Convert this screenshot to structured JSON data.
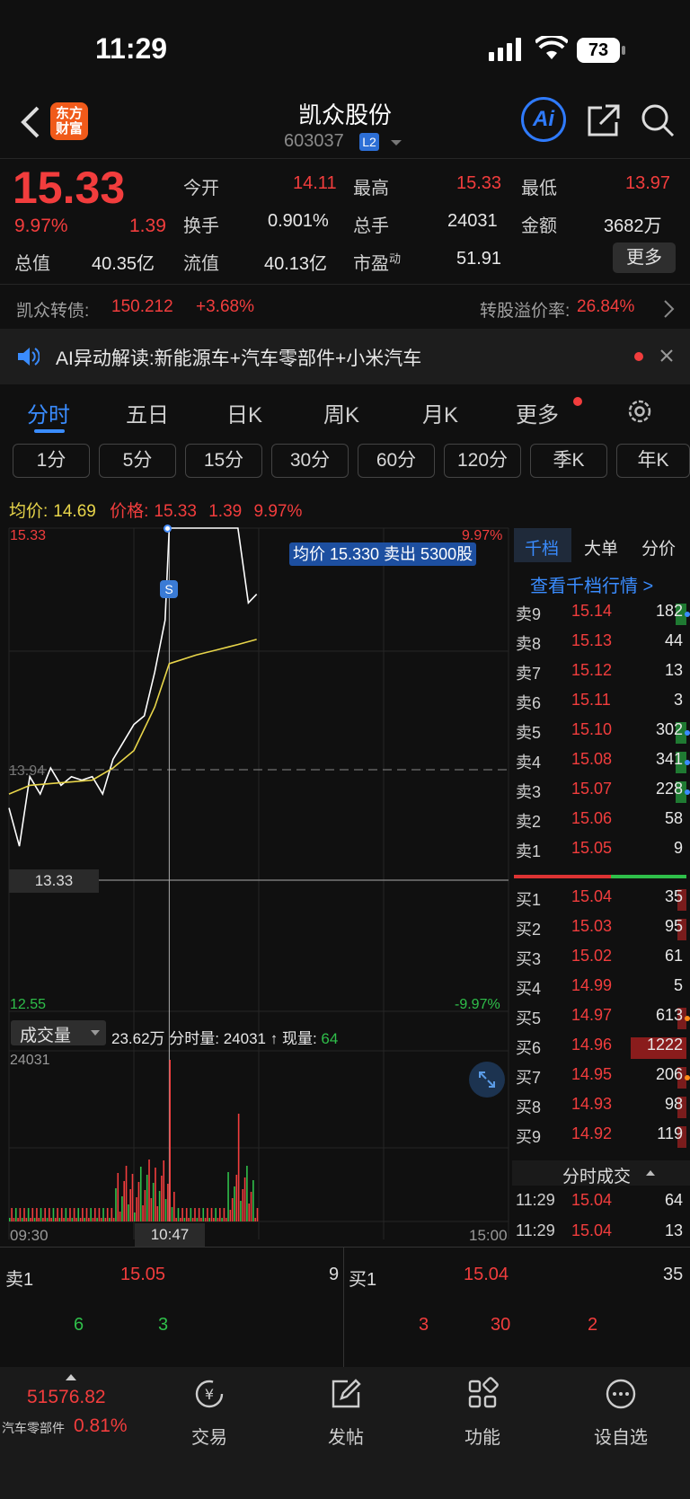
{
  "status_bar": {
    "time": "11:29",
    "battery": "73"
  },
  "nav": {
    "brand": "东方\n财富",
    "title": "凯众股份",
    "code": "603037",
    "level": "L2"
  },
  "quote": {
    "price": "15.33",
    "change_pct": "9.97%",
    "change": "1.39",
    "fields": [
      {
        "label": "今开",
        "value": "14.11",
        "color": "red"
      },
      {
        "label": "最高",
        "value": "15.33",
        "color": "red"
      },
      {
        "label": "最低",
        "value": "13.97",
        "color": "red"
      },
      {
        "label": "换手",
        "value": "0.901%",
        "color": "white"
      },
      {
        "label": "总手",
        "value": "24031",
        "color": "white"
      },
      {
        "label": "金额",
        "value": "3682万",
        "color": "white"
      },
      {
        "label": "总值",
        "value": "40.35亿",
        "color": "white"
      },
      {
        "label": "流值",
        "value": "40.13亿",
        "color": "white"
      },
      {
        "label": "市盈",
        "value": "51.91",
        "color": "white",
        "sup": "动"
      }
    ],
    "more_label": "更多"
  },
  "bond": {
    "name": "凯众转债:",
    "price": "150.212",
    "change": "+3.68%",
    "premium_label": "转股溢价率:",
    "premium": "26.84%"
  },
  "ai_bar": {
    "text": "AI异动解读:新能源车+汽车零部件+小米汽车"
  },
  "tabs": [
    "分时",
    "五日",
    "日K",
    "周K",
    "月K",
    "更多"
  ],
  "periods": [
    "1分",
    "5分",
    "15分",
    "30分",
    "60分",
    "120分",
    "季K",
    "年K"
  ],
  "chart_info": {
    "avg_label": "均价:",
    "avg_value": "14.69",
    "price_label": "价格:",
    "price_value": "15.33",
    "chg": "1.39",
    "pct": "9.97%"
  },
  "chart_labels": {
    "top_price": "15.33",
    "top_pct": "9.97%",
    "mid_price": "13.94",
    "cursor_price": "13.33",
    "bottom_price": "12.55",
    "bottom_pct": "-9.97%",
    "tooltip": "均价 15.330 卖出 5300股",
    "marker": "S",
    "volume_select": "成交量",
    "volume_info_amount": "23.62万",
    "volume_info_label": "分时量: 24031 ↑ 现量:",
    "volume_info_now": "64",
    "volume_max": "24031",
    "t_start": "09:30",
    "t_cursor": "10:47",
    "t_end": "15:00"
  },
  "chart_data": {
    "type": "line",
    "ylim": [
      12.55,
      15.33
    ],
    "series": [
      {
        "name": "价格",
        "x": [
          "09:30",
          "09:35",
          "09:40",
          "09:45",
          "09:50",
          "09:55",
          "10:00",
          "10:05",
          "10:10",
          "10:15",
          "10:20",
          "10:25",
          "10:30",
          "10:35",
          "10:40",
          "10:45",
          "10:47",
          "11:00",
          "11:10",
          "11:20",
          "11:25",
          "11:29"
        ],
        "values": [
          13.72,
          13.5,
          13.9,
          13.8,
          13.95,
          13.85,
          13.9,
          13.88,
          13.9,
          13.8,
          14.0,
          14.1,
          14.2,
          14.25,
          14.5,
          14.8,
          15.33,
          15.33,
          15.33,
          15.33,
          14.9,
          14.95
        ]
      },
      {
        "name": "均价",
        "x": [
          "09:30",
          "09:40",
          "09:50",
          "10:00",
          "10:10",
          "10:20",
          "10:30",
          "10:40",
          "10:47",
          "11:00",
          "11:10",
          "11:20",
          "11:29"
        ],
        "values": [
          13.8,
          13.85,
          13.86,
          13.87,
          13.88,
          13.95,
          14.05,
          14.3,
          14.55,
          14.6,
          14.63,
          14.66,
          14.69
        ]
      }
    ],
    "volume": {
      "max": 24031
    }
  },
  "order_tabs": [
    "千档",
    "大单",
    "分价"
  ],
  "order_link": "查看千档行情 >",
  "asks": [
    {
      "label": "卖9",
      "price": "15.14",
      "vol": "182",
      "dot": "#3a8cff",
      "bar": "green"
    },
    {
      "label": "卖8",
      "price": "15.13",
      "vol": "44"
    },
    {
      "label": "卖7",
      "price": "15.12",
      "vol": "13"
    },
    {
      "label": "卖6",
      "price": "15.11",
      "vol": "3"
    },
    {
      "label": "卖5",
      "price": "15.10",
      "vol": "302",
      "dot": "#3a8cff",
      "bar": "green"
    },
    {
      "label": "卖4",
      "price": "15.08",
      "vol": "341",
      "dot": "#3a8cff",
      "bar": "green"
    },
    {
      "label": "卖3",
      "price": "15.07",
      "vol": "228",
      "dot": "#3a8cff",
      "bar": "green"
    },
    {
      "label": "卖2",
      "price": "15.06",
      "vol": "58"
    },
    {
      "label": "卖1",
      "price": "15.05",
      "vol": "9"
    }
  ],
  "bids": [
    {
      "label": "买1",
      "price": "15.04",
      "vol": "35",
      "bar": "red"
    },
    {
      "label": "买2",
      "price": "15.03",
      "vol": "95",
      "bar": "red"
    },
    {
      "label": "买3",
      "price": "15.02",
      "vol": "61"
    },
    {
      "label": "买4",
      "price": "14.99",
      "vol": "5"
    },
    {
      "label": "买5",
      "price": "14.97",
      "vol": "613",
      "dot": "#ff8a1a",
      "bar": "red"
    },
    {
      "label": "买6",
      "price": "14.96",
      "vol": "1222",
      "bar": "bigred"
    },
    {
      "label": "买7",
      "price": "14.95",
      "vol": "206",
      "dot": "#ff8a1a",
      "bar": "red"
    },
    {
      "label": "买8",
      "price": "14.93",
      "vol": "98",
      "bar": "red"
    },
    {
      "label": "买9",
      "price": "14.92",
      "vol": "119",
      "bar": "red"
    }
  ],
  "trades": {
    "title": "分时成交",
    "rows": [
      {
        "time": "11:29",
        "price": "15.04",
        "vol": "64"
      },
      {
        "time": "11:29",
        "price": "15.04",
        "vol": "13"
      }
    ]
  },
  "bottom_quote": {
    "sell_label": "卖1",
    "sell_price": "15.05",
    "sell_vol": "9",
    "buy_label": "买1",
    "buy_price": "15.04",
    "buy_vol": "35",
    "sell_queue": [
      "6",
      "3"
    ],
    "buy_queue": [
      "3",
      "30",
      "2"
    ]
  },
  "index": {
    "value": "51576.82",
    "name": "汽车零部件",
    "pct": "0.81%"
  },
  "bottom_nav": [
    "交易",
    "发帖",
    "功能",
    "设自选"
  ]
}
